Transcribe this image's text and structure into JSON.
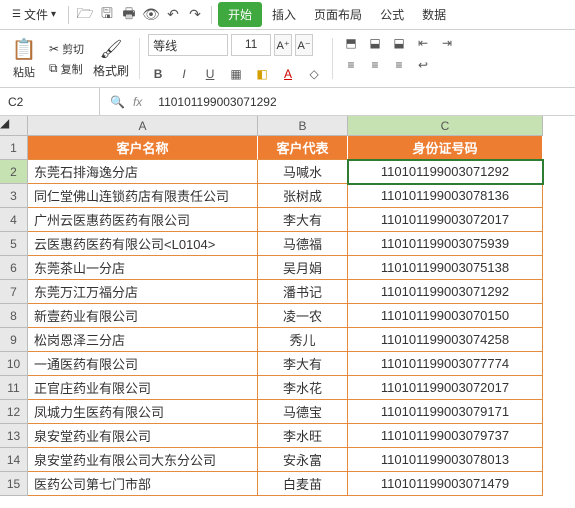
{
  "menu": {
    "file": "文件",
    "tabs": {
      "start": "开始",
      "insert": "插入",
      "layout": "页面布局",
      "formula": "公式",
      "data": "数据"
    }
  },
  "ribbon": {
    "paste": "粘贴",
    "cut": "剪切",
    "copy": "复制",
    "format_painter": "格式刷",
    "font_name": "等线",
    "font_size": "11"
  },
  "formula_bar": {
    "name_box": "C2",
    "fx": "fx",
    "value": "110101199003071292"
  },
  "columns": [
    "A",
    "B",
    "C"
  ],
  "row_numbers": [
    1,
    2,
    3,
    4,
    5,
    6,
    7,
    8,
    9,
    10,
    11,
    12,
    13,
    14,
    15
  ],
  "headers": {
    "name": "客户名称",
    "rep": "客户代表",
    "id": "身份证号码"
  },
  "selected_cell": "C2",
  "rows": [
    {
      "name": "东莞石排海逸分店",
      "rep": "马喊水",
      "id": "110101199003071292"
    },
    {
      "name": "同仁堂佛山连锁药店有限责任公司",
      "rep": "张树成",
      "id": "110101199003078136"
    },
    {
      "name": "广州云医惠药医药有限公司",
      "rep": "李大有",
      "id": "110101199003072017"
    },
    {
      "name": "云医惠药医药有限公司<L0104>",
      "rep": "马德福",
      "id": "110101199003075939"
    },
    {
      "name": "东莞茶山一分店",
      "rep": "吴月娟",
      "id": "110101199003075138"
    },
    {
      "name": "东莞万江万福分店",
      "rep": "潘书记",
      "id": "110101199003071292"
    },
    {
      "name": "新壹药业有限公司",
      "rep": "凌一农",
      "id": "110101199003070150"
    },
    {
      "name": "松岗恩泽三分店",
      "rep": "秀儿",
      "id": "110101199003074258"
    },
    {
      "name": "一通医药有限公司",
      "rep": "李大有",
      "id": "110101199003077774"
    },
    {
      "name": "正官庄药业有限公司",
      "rep": "李水花",
      "id": "110101199003072017"
    },
    {
      "name": "凤城力生医药有限公司",
      "rep": "马德宝",
      "id": "110101199003079171"
    },
    {
      "name": "泉安堂药业有限公司",
      "rep": "李水旺",
      "id": "110101199003079737"
    },
    {
      "name": "泉安堂药业有限公司大东分公司",
      "rep": "安永富",
      "id": "110101199003078013"
    },
    {
      "name": "医药公司第七门市部",
      "rep": "白麦苗",
      "id": "110101199003071479"
    }
  ]
}
